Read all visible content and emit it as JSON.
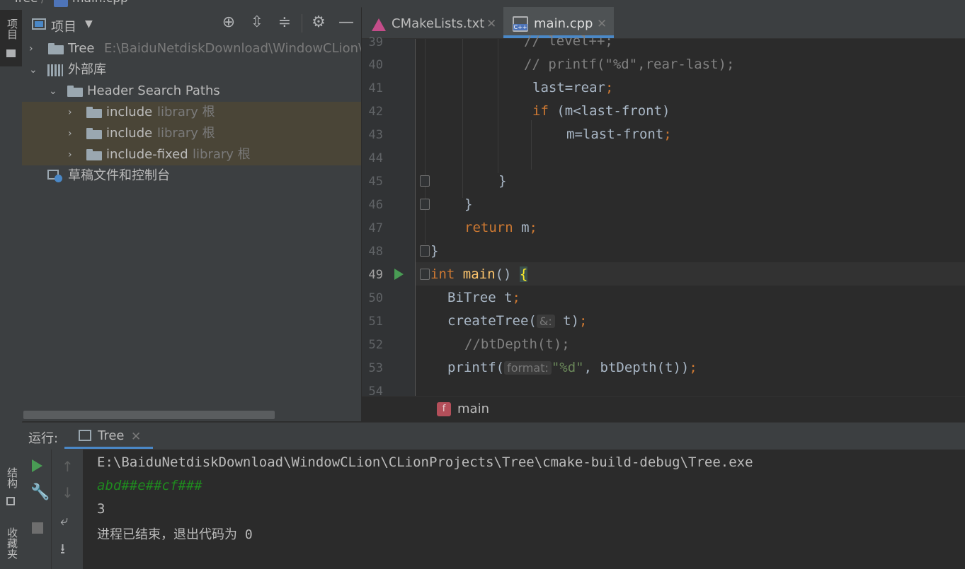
{
  "breadcrumb": {
    "project": "Tree",
    "file": "main.cpp"
  },
  "left_strip": {
    "project_tab": "项目",
    "structure_tab": "结构",
    "favorites_tab": "收藏夹"
  },
  "project_panel": {
    "title": "项目",
    "tree": [
      {
        "label": "Tree",
        "path": "E:\\BaiduNetdiskDownload\\WindowCLion\\C"
      },
      {
        "label": "外部库"
      },
      {
        "label": "Header Search Paths"
      },
      {
        "label": "include",
        "suffix": "library 根"
      },
      {
        "label": "include",
        "suffix": "library 根"
      },
      {
        "label": "include-fixed",
        "suffix": "library 根"
      },
      {
        "label": "草稿文件和控制台"
      }
    ]
  },
  "editor": {
    "tabs": [
      {
        "label": "CMakeLists.txt"
      },
      {
        "label": "main.cpp",
        "active": true
      }
    ],
    "lines": [
      {
        "num": "39",
        "text": "// level++;"
      },
      {
        "num": "40",
        "text": "// printf(\"%d\",rear-last);"
      },
      {
        "num": "41",
        "a": "last=rear",
        "b": ";"
      },
      {
        "num": "42",
        "kw": "if",
        "rest": " (m<last-front)"
      },
      {
        "num": "43",
        "a": "m=last-front",
        "b": ";"
      },
      {
        "num": "44"
      },
      {
        "num": "45",
        "text": "}"
      },
      {
        "num": "46",
        "text": "}"
      },
      {
        "num": "47",
        "kw": "return",
        "rest": " m",
        "b": ";"
      },
      {
        "num": "48",
        "text": "}"
      },
      {
        "num": "49",
        "kw": "int",
        "fn": "main",
        "rest": "() ",
        "brace": "{"
      },
      {
        "num": "50",
        "a": "BiTree t",
        "b": ";"
      },
      {
        "num": "51",
        "a": "createTree(",
        "hint": "&:",
        "rest": " t)",
        "b": ";"
      },
      {
        "num": "52",
        "text": "//btDepth(t);"
      },
      {
        "num": "53",
        "a": "printf(",
        "hint": "format:",
        "str": "\"%d\"",
        "rest": ", btDepth(t))",
        "b": ";"
      },
      {
        "num": "54"
      }
    ],
    "code_breadcrumb": {
      "badge": "f",
      "label": "main"
    }
  },
  "run_panel": {
    "label": "运行:",
    "tab": "Tree",
    "console": [
      "E:\\BaiduNetdiskDownload\\WindowCLion\\CLionProjects\\Tree\\cmake-build-debug\\Tree.exe",
      "abd##e##cf###",
      "3",
      "进程已结束，退出代码为 0"
    ]
  },
  "colors": {
    "keyword": "#cc7832",
    "function": "#ffc66d",
    "string": "#6a8759",
    "comment": "#808080",
    "accent": "#4a88c7",
    "input_text": "#1f8a1f"
  }
}
